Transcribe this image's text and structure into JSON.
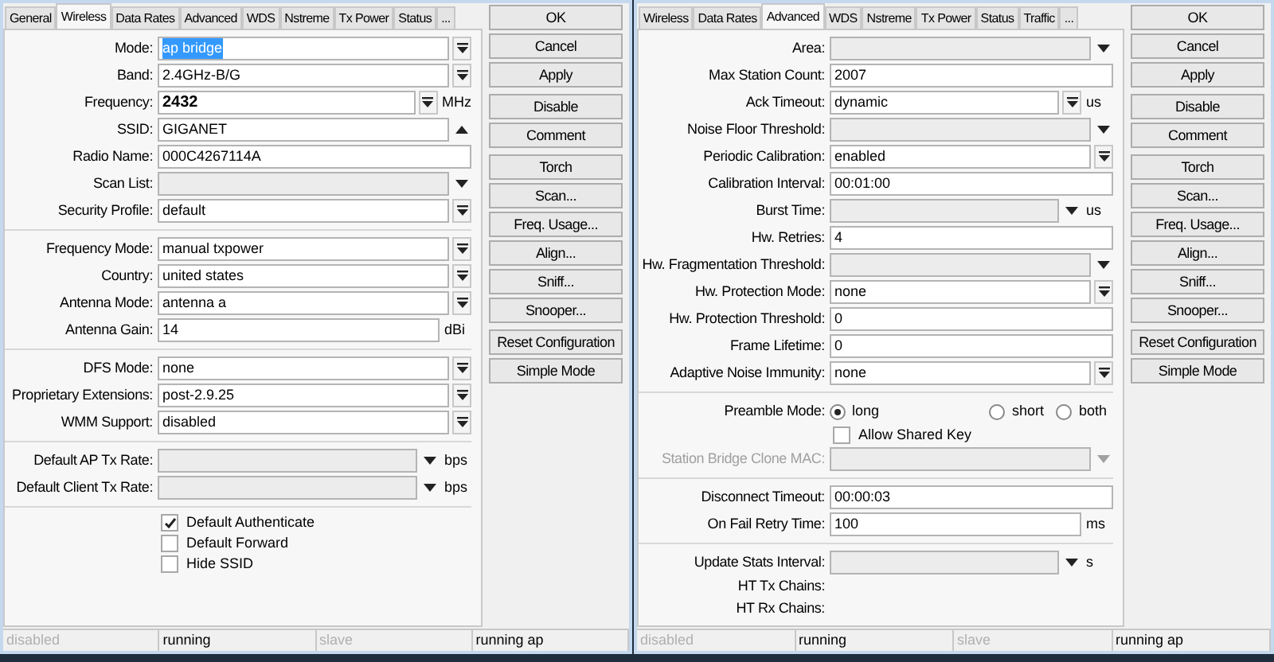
{
  "windows": [
    {
      "tabs": [
        {
          "label": "General",
          "selected": false
        },
        {
          "label": "Wireless",
          "selected": true
        },
        {
          "label": "Data Rates",
          "selected": false
        },
        {
          "label": "Advanced",
          "selected": false
        },
        {
          "label": "WDS",
          "selected": false
        },
        {
          "label": "Nstreme",
          "selected": false
        },
        {
          "label": "Tx Power",
          "selected": false
        },
        {
          "label": "Status",
          "selected": false
        },
        {
          "label": "...",
          "selected": false
        }
      ],
      "rows": [
        {
          "kind": "dropdown",
          "label": "Mode:",
          "value": "ap bridge",
          "highlighted": true
        },
        {
          "kind": "dropdown",
          "label": "Band:",
          "value": "2.4GHz-B/G"
        },
        {
          "kind": "dropdown",
          "label": "Frequency:",
          "value": "2432",
          "unit": "MHz",
          "bold": true
        },
        {
          "kind": "expander",
          "label": "SSID:",
          "value": "GIGANET"
        },
        {
          "kind": "field",
          "label": "Radio Name:",
          "value": "000C4267114A"
        },
        {
          "kind": "combo",
          "label": "Scan List:",
          "unset": true
        },
        {
          "kind": "dropdown",
          "label": "Security Profile:",
          "value": "default"
        },
        {
          "kind": "separator"
        },
        {
          "kind": "dropdown",
          "label": "Frequency Mode:",
          "value": "manual txpower"
        },
        {
          "kind": "dropdown",
          "label": "Country:",
          "value": "united states"
        },
        {
          "kind": "dropdown",
          "label": "Antenna Mode:",
          "value": "antenna a"
        },
        {
          "kind": "field",
          "label": "Antenna Gain:",
          "value": "14",
          "unit": "dBi"
        },
        {
          "kind": "separator"
        },
        {
          "kind": "dropdown",
          "label": "DFS Mode:",
          "value": "none"
        },
        {
          "kind": "dropdown",
          "label": "Proprietary Extensions:",
          "value": "post-2.9.25"
        },
        {
          "kind": "dropdown",
          "label": "WMM Support:",
          "value": "disabled"
        },
        {
          "kind": "separator"
        },
        {
          "kind": "combo",
          "label": "Default AP Tx Rate:",
          "unset": true,
          "unit": "bps"
        },
        {
          "kind": "combo",
          "label": "Default Client Tx Rate:",
          "unset": true,
          "unit": "bps"
        },
        {
          "kind": "separator"
        },
        {
          "kind": "checkbox",
          "text": "Default Authenticate",
          "checked": true
        },
        {
          "kind": "checkbox",
          "text": "Default Forward",
          "checked": false
        },
        {
          "kind": "checkbox",
          "text": "Hide SSID",
          "checked": false
        }
      ],
      "button_groups": [
        [
          "OK",
          "Cancel",
          "Apply"
        ],
        [
          "Disable",
          "Comment"
        ],
        [
          "Torch",
          "Scan...",
          "Freq. Usage...",
          "Align...",
          "Sniff...",
          "Snooper..."
        ],
        [
          "Reset Configuration",
          "Simple Mode"
        ]
      ],
      "status_bar": [
        {
          "text": "disabled",
          "dimmed": true
        },
        {
          "text": "running",
          "dimmed": false
        },
        {
          "text": "slave",
          "dimmed": true
        },
        {
          "text": "running ap",
          "dimmed": false
        }
      ]
    },
    {
      "tabs": [
        {
          "label": "Wireless",
          "selected": false
        },
        {
          "label": "Data Rates",
          "selected": false
        },
        {
          "label": "Advanced",
          "selected": true
        },
        {
          "label": "WDS",
          "selected": false
        },
        {
          "label": "Nstreme",
          "selected": false
        },
        {
          "label": "Tx Power",
          "selected": false
        },
        {
          "label": "Status",
          "selected": false
        },
        {
          "label": "Traffic",
          "selected": false
        },
        {
          "label": "...",
          "selected": false
        }
      ],
      "rows": [
        {
          "kind": "combo",
          "label": "Area:",
          "unset": true
        },
        {
          "kind": "field",
          "label": "Max Station Count:",
          "value": "2007"
        },
        {
          "kind": "dropdown",
          "label": "Ack Timeout:",
          "value": "dynamic",
          "unit": "us"
        },
        {
          "kind": "combo",
          "label": "Noise Floor Threshold:",
          "unset": true
        },
        {
          "kind": "dropdown",
          "label": "Periodic Calibration:",
          "value": "enabled"
        },
        {
          "kind": "field",
          "label": "Calibration Interval:",
          "value": "00:01:00"
        },
        {
          "kind": "combo",
          "label": "Burst Time:",
          "unset": true,
          "unit": "us"
        },
        {
          "kind": "field",
          "label": "Hw. Retries:",
          "value": "4"
        },
        {
          "kind": "combo",
          "label": "Hw. Fragmentation Threshold:",
          "unset": true
        },
        {
          "kind": "dropdown",
          "label": "Hw. Protection Mode:",
          "value": "none"
        },
        {
          "kind": "field",
          "label": "Hw. Protection Threshold:",
          "value": "0"
        },
        {
          "kind": "field",
          "label": "Frame Lifetime:",
          "value": "0"
        },
        {
          "kind": "dropdown",
          "label": "Adaptive Noise Immunity:",
          "value": "none"
        },
        {
          "kind": "separator"
        },
        {
          "kind": "radio",
          "label": "Preamble Mode:",
          "options": [
            {
              "text": "long",
              "selected": true
            },
            {
              "text": "short",
              "selected": false
            },
            {
              "text": "both",
              "selected": false
            }
          ]
        },
        {
          "kind": "checkbox",
          "text": "Allow Shared Key",
          "checked": false
        },
        {
          "kind": "combo",
          "label": "Station Bridge Clone MAC:",
          "unset": true,
          "disabled": true
        },
        {
          "kind": "separator"
        },
        {
          "kind": "field",
          "label": "Disconnect Timeout:",
          "value": "00:00:03"
        },
        {
          "kind": "field",
          "label": "On Fail Retry Time:",
          "value": "100",
          "unit": "ms"
        },
        {
          "kind": "separator"
        },
        {
          "kind": "combo",
          "label": "Update Stats Interval:",
          "unset": true,
          "unit": "s"
        },
        {
          "kind": "label",
          "label": "HT Tx Chains:"
        },
        {
          "kind": "label",
          "label": "HT Rx Chains:"
        }
      ],
      "button_groups": [
        [
          "OK",
          "Cancel",
          "Apply"
        ],
        [
          "Disable",
          "Comment"
        ],
        [
          "Torch",
          "Scan...",
          "Freq. Usage...",
          "Align...",
          "Sniff...",
          "Snooper..."
        ],
        [
          "Reset Configuration",
          "Simple Mode"
        ]
      ],
      "status_bar": [
        {
          "text": "disabled",
          "dimmed": true
        },
        {
          "text": "running",
          "dimmed": false
        },
        {
          "text": "slave",
          "dimmed": true
        },
        {
          "text": "running ap",
          "dimmed": false
        }
      ]
    }
  ]
}
